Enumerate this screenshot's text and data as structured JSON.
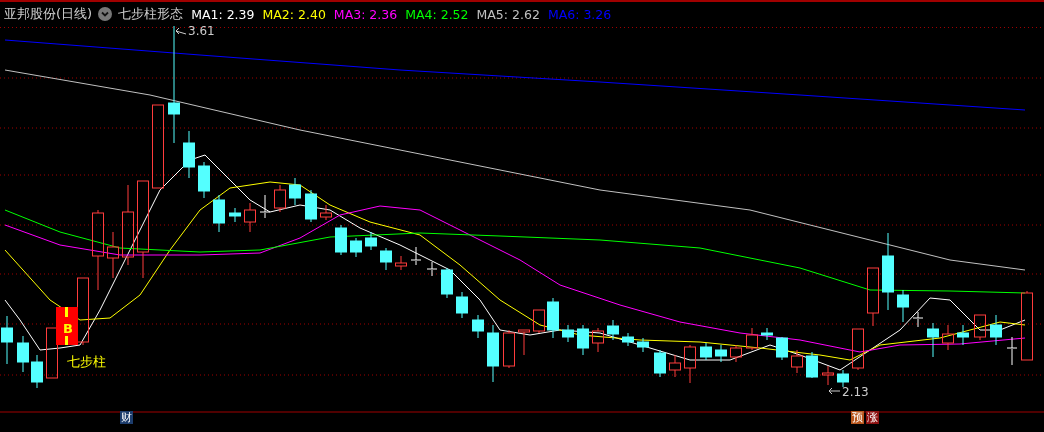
{
  "header": {
    "stock": "亚邦股份(日线)",
    "indicator": "七步柱形态",
    "ma": [
      {
        "label": "MA1:",
        "value": "2.39",
        "color": "#ffffff"
      },
      {
        "label": "MA2:",
        "value": "2.40",
        "color": "#ffff00"
      },
      {
        "label": "MA3:",
        "value": "2.36",
        "color": "#ff00ff"
      },
      {
        "label": "MA4:",
        "value": "2.52",
        "color": "#00ff00"
      },
      {
        "label": "MA5:",
        "value": "2.62",
        "color": "#c0c0c0"
      },
      {
        "label": "MA6:",
        "value": "3.26",
        "color": "#0000ff"
      }
    ]
  },
  "chart": {
    "high_label": "3.61",
    "low_label": "2.13",
    "signal_mark": "B",
    "signal_label": "七步柱",
    "events": [
      {
        "label": "财",
        "color": "#1c3c6c"
      },
      {
        "label": "预",
        "color": "#b8561c"
      },
      {
        "label": "涨",
        "color": "#8c1010"
      }
    ]
  }
}
